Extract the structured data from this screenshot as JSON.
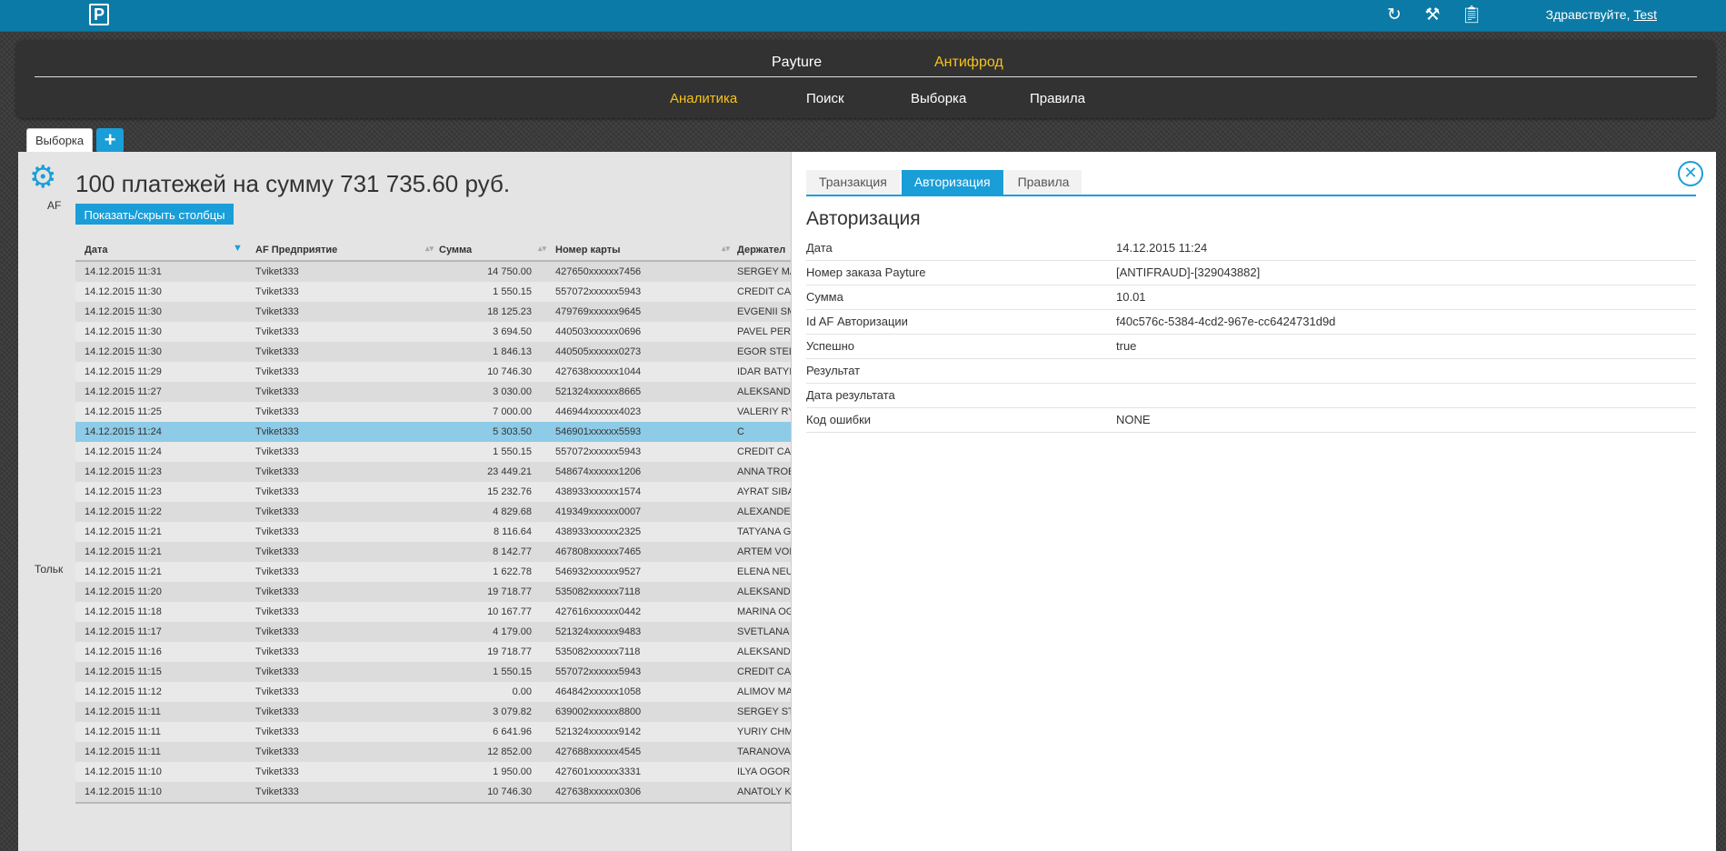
{
  "header": {
    "logo_letter": "P",
    "icons": [
      "refresh-icon",
      "tools-icon",
      "clipboard-icon"
    ],
    "greeting_prefix": "Здравствуйте,",
    "username": "Test"
  },
  "nav": {
    "top": [
      "Payture",
      "Антифрод"
    ],
    "bottom": [
      "Аналитика",
      "Поиск",
      "Выборка",
      "Правила"
    ],
    "active_top": "Антифрод",
    "active_bottom": "Аналитика"
  },
  "tabs": {
    "selection_label": "Выборка",
    "add_label": "+"
  },
  "main": {
    "summary": "100 платежей на сумму 731 735.60 руб.",
    "toggle_columns_label": "Показать/скрыть столбцы",
    "left_cut_af": "AF",
    "left_cut_tol": "Тольк",
    "columns": [
      "Дата",
      "AF Предприятие",
      "Сумма",
      "Номер карты",
      "Держател"
    ],
    "rows": [
      [
        "14.12.2015 11:31",
        "Tviket333",
        "14 750.00",
        "427650xxxxxx7456",
        "SERGEY MA"
      ],
      [
        "14.12.2015 11:30",
        "Tviket333",
        "1 550.15",
        "557072xxxxxx5943",
        "CREDIT CAI"
      ],
      [
        "14.12.2015 11:30",
        "Tviket333",
        "18 125.23",
        "479769xxxxxx9645",
        "EVGENII SM"
      ],
      [
        "14.12.2015 11:30",
        "Tviket333",
        "3 694.50",
        "440503xxxxxx0696",
        "PAVEL PERE"
      ],
      [
        "14.12.2015 11:30",
        "Tviket333",
        "1 846.13",
        "440505xxxxxx0273",
        "EGOR STEL"
      ],
      [
        "14.12.2015 11:29",
        "Tviket333",
        "10 746.30",
        "427638xxxxxx1044",
        "IDAR BATYI"
      ],
      [
        "14.12.2015 11:27",
        "Tviket333",
        "3 030.00",
        "521324xxxxxx8665",
        "ALEKSANDI"
      ],
      [
        "14.12.2015 11:25",
        "Tviket333",
        "7 000.00",
        "446944xxxxxx4023",
        "VALERIY RY"
      ],
      [
        "14.12.2015 11:24",
        "Tviket333",
        "5 303.50",
        "546901xxxxxx5593",
        "C"
      ],
      [
        "14.12.2015 11:24",
        "Tviket333",
        "1 550.15",
        "557072xxxxxx5943",
        "CREDIT CAI"
      ],
      [
        "14.12.2015 11:23",
        "Tviket333",
        "23 449.21",
        "548674xxxxxx1206",
        "ANNA TROE"
      ],
      [
        "14.12.2015 11:23",
        "Tviket333",
        "15 232.76",
        "438933xxxxxx1574",
        "AYRAT SIBA"
      ],
      [
        "14.12.2015 11:22",
        "Tviket333",
        "4 829.68",
        "419349xxxxxx0007",
        "ALEXANDER"
      ],
      [
        "14.12.2015 11:21",
        "Tviket333",
        "8 116.64",
        "438933xxxxxx2325",
        "TATYANA G"
      ],
      [
        "14.12.2015 11:21",
        "Tviket333",
        "8 142.77",
        "467808xxxxxx7465",
        "ARTEM VOII"
      ],
      [
        "14.12.2015 11:21",
        "Tviket333",
        "1 622.78",
        "546932xxxxxx9527",
        "ELENA NEUI"
      ],
      [
        "14.12.2015 11:20",
        "Tviket333",
        "19 718.77",
        "535082xxxxxx7118",
        "ALEKSANDI"
      ],
      [
        "14.12.2015 11:18",
        "Tviket333",
        "10 167.77",
        "427616xxxxxx0442",
        "MARINA OG"
      ],
      [
        "14.12.2015 11:17",
        "Tviket333",
        "4 179.00",
        "521324xxxxxx9483",
        "SVETLANA I"
      ],
      [
        "14.12.2015 11:16",
        "Tviket333",
        "19 718.77",
        "535082xxxxxx7118",
        "ALEKSANDI"
      ],
      [
        "14.12.2015 11:15",
        "Tviket333",
        "1 550.15",
        "557072xxxxxx5943",
        "CREDIT CAI"
      ],
      [
        "14.12.2015 11:12",
        "Tviket333",
        "0.00",
        "464842xxxxxx1058",
        "ALIMOV MA"
      ],
      [
        "14.12.2015 11:11",
        "Tviket333",
        "3 079.82",
        "639002xxxxxx8800",
        "SERGEY STI"
      ],
      [
        "14.12.2015 11:11",
        "Tviket333",
        "6 641.96",
        "521324xxxxxx9142",
        "YURIY CHMI"
      ],
      [
        "14.12.2015 11:11",
        "Tviket333",
        "12 852.00",
        "427688xxxxxx4545",
        "TARANOVA"
      ],
      [
        "14.12.2015 11:10",
        "Tviket333",
        "1 950.00",
        "427601xxxxxx3331",
        "ILYA OGOR"
      ],
      [
        "14.12.2015 11:10",
        "Tviket333",
        "10 746.30",
        "427638xxxxxx0306",
        "ANATOLY K"
      ]
    ],
    "selected_row_index": 8
  },
  "detail": {
    "tabs": [
      "Транзакция",
      "Авторизация",
      "Правила"
    ],
    "active_tab": "Авторизация",
    "title": "Авторизация",
    "close_icon": "close-circle-icon",
    "fields": [
      {
        "label": "Дата",
        "value": "14.12.2015 11:24"
      },
      {
        "label": "Номер заказа Payture",
        "value": "[ANTIFRAUD]-[329043882]"
      },
      {
        "label": "Сумма",
        "value": "10.01"
      },
      {
        "label": "Id AF Авторизации",
        "value": "f40c576c-5384-4cd2-967e-cc6424731d9d"
      },
      {
        "label": "Успешно",
        "value": "true"
      },
      {
        "label": "Результат",
        "value": ""
      },
      {
        "label": "Дата результата",
        "value": ""
      },
      {
        "label": "Код ошибки",
        "value": "NONE"
      }
    ]
  },
  "colors": {
    "accent": "#1a9ed8",
    "topbar": "#0b7aa6",
    "nav_active": "#f6c31c",
    "selected_row": "#8dcbe7"
  }
}
